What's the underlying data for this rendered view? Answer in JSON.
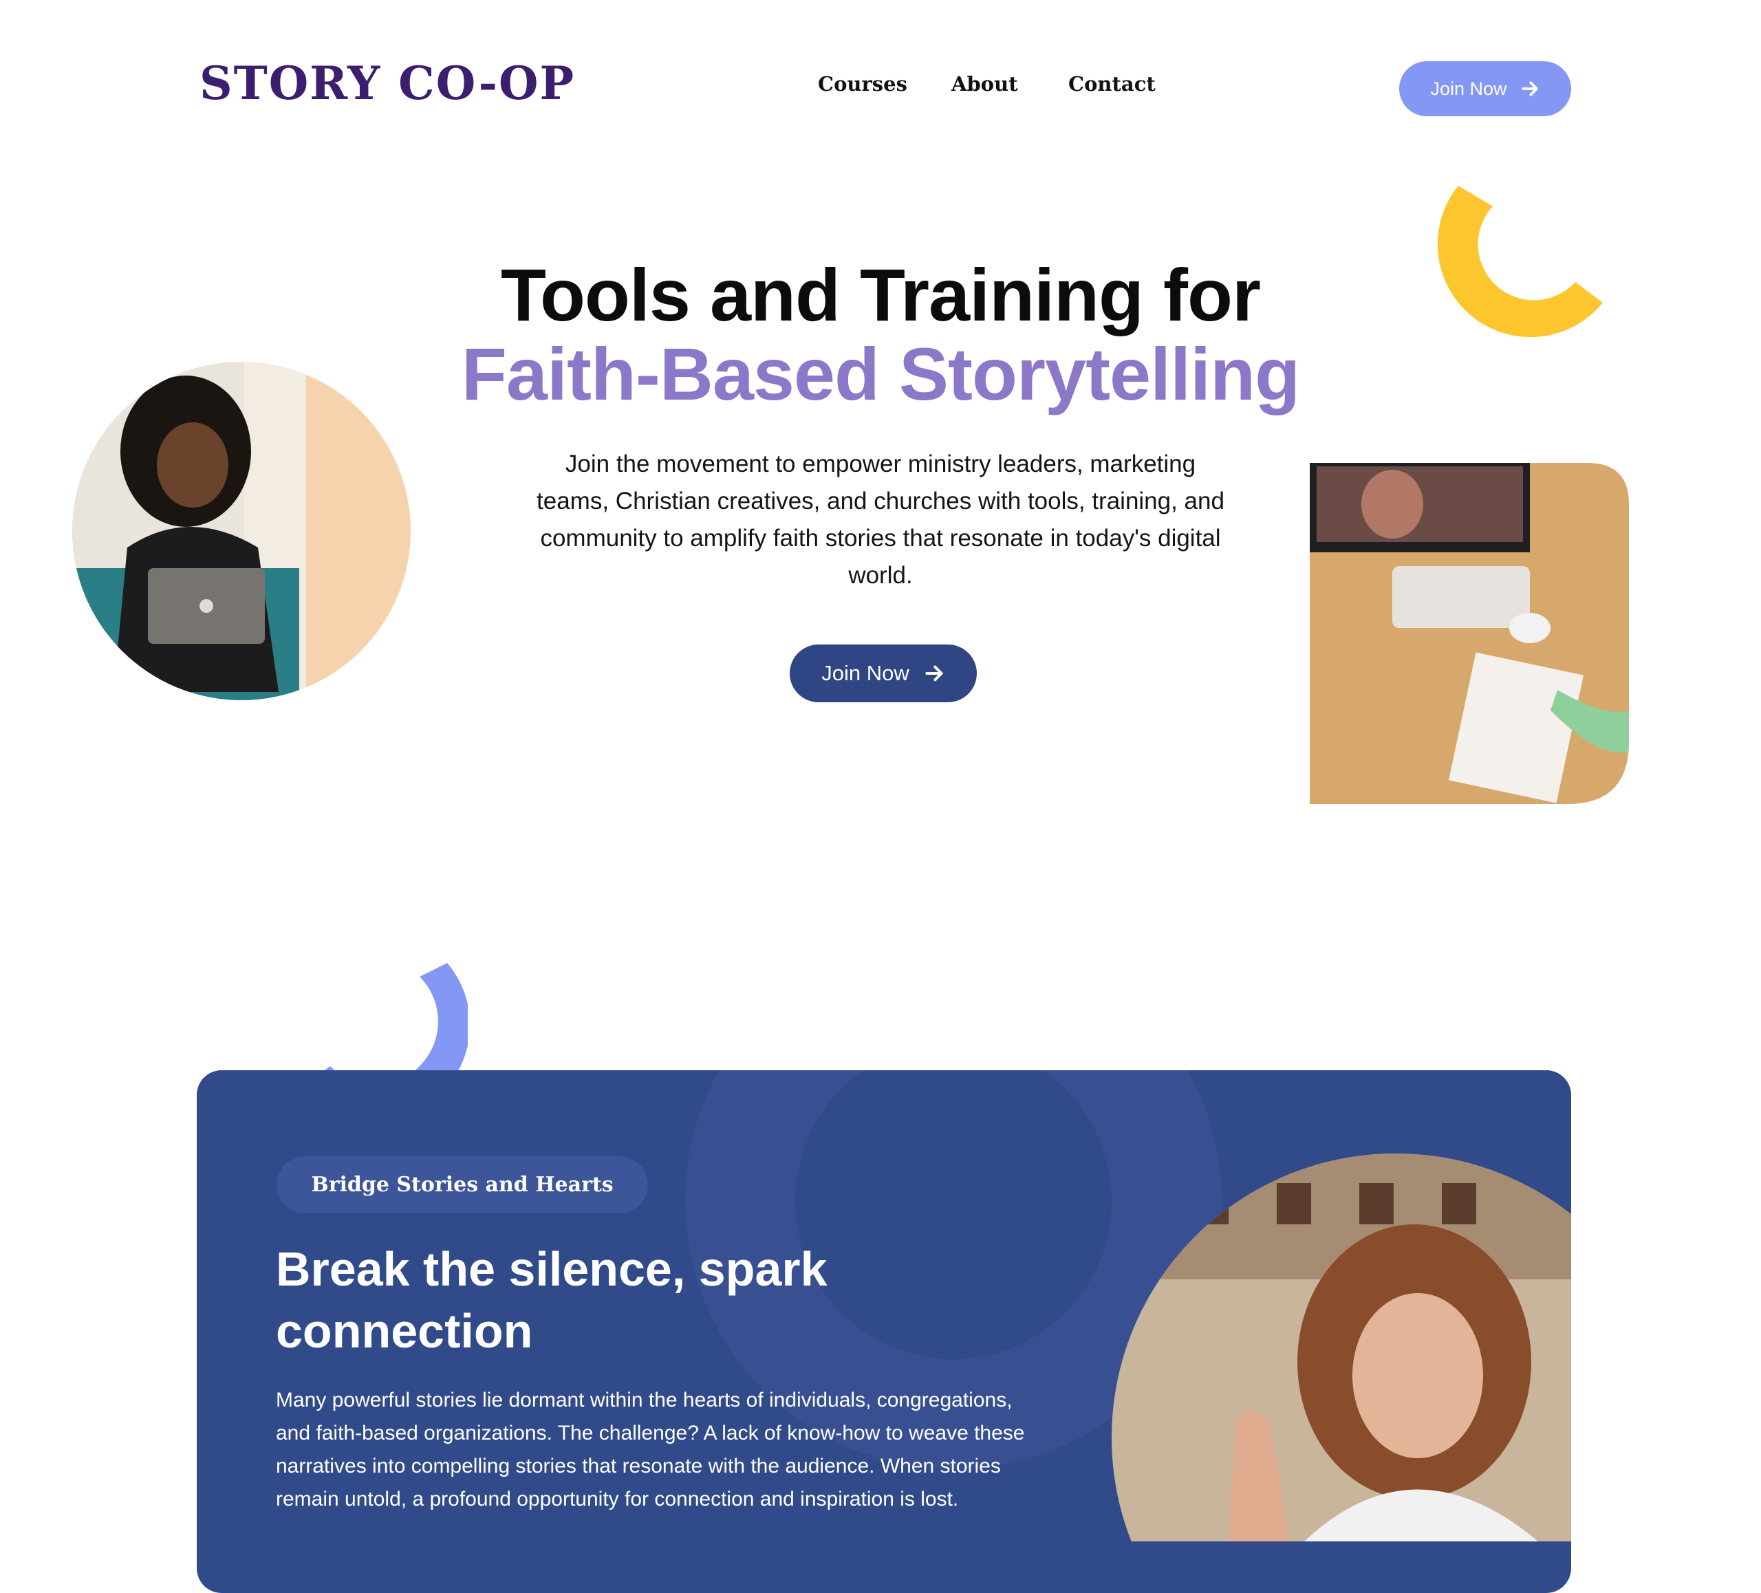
{
  "header": {
    "logo": "STORY CO-OP",
    "nav": [
      "Courses",
      "About",
      "Contact"
    ],
    "cta_label": "Join Now"
  },
  "hero": {
    "title_line1": "Tools and Training for",
    "title_line2": "Faith-Based Storytelling",
    "description": "Join the movement to empower ministry leaders, marketing teams, Christian creatives, and churches with tools, training, and community to amplify faith stories that resonate in today's digital world.",
    "cta_label": "Join Now"
  },
  "feature": {
    "tag": "Bridge Stories and Hearts",
    "title": "Break the silence, spark connection",
    "body": "Many powerful stories lie dormant within the hearts of individuals, congregations, and faith-based organizations. The challenge? A lack of know-how to weave these narratives into compelling stories that resonate with the audience. When stories remain untold, a profound opportunity for connection and inspiration is lost."
  },
  "icons": [
    "arrow-right-icon",
    "arrow-right-icon"
  ],
  "colors": {
    "brand_dark": "#3b1f6e",
    "accent_purple": "#8b78c9",
    "button_light": "#8597f5",
    "button_dark": "#2f4584",
    "card_bg": "#314a8a",
    "decor_yellow": "#fec62e",
    "decor_blue": "#8597f5"
  }
}
